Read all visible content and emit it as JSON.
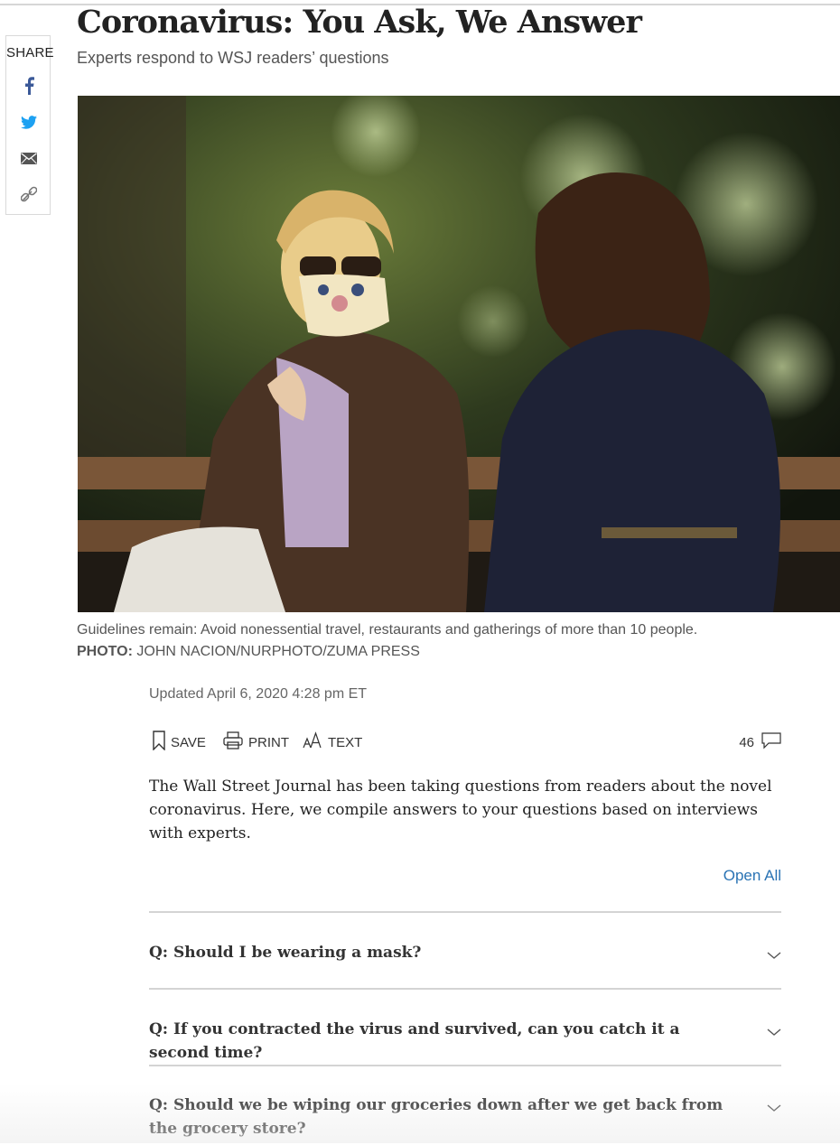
{
  "share": {
    "label": "SHARE",
    "buttons": [
      {
        "icon": "facebook-icon",
        "color": "#3b5998"
      },
      {
        "icon": "twitter-icon",
        "color": "#1da1f2"
      },
      {
        "icon": "email-icon",
        "color": "#555555"
      },
      {
        "icon": "link-icon",
        "color": "#666666"
      }
    ]
  },
  "article": {
    "headline": "Coronavirus: You Ask, We Answer",
    "dek": "Experts respond to WSJ readers’ questions",
    "caption": "Guidelines remain: Avoid nonessential travel, restaurants and gatherings of more than 10 people.",
    "credit_label": "PHOTO:",
    "credit": " JOHN NACION/NURPHOTO/ZUMA PRESS",
    "updated": "Updated April 6, 2020 4:28 pm ET",
    "intro": "The Wall Street Journal has been taking questions from readers about the novel coronavirus. Here, we compile answers to your questions based on interviews with experts."
  },
  "tools": {
    "save": "SAVE",
    "print": "PRINT",
    "text": "TEXT",
    "comments_count": "46"
  },
  "open_all": "Open All",
  "faqs": [
    "Q: Should I be wearing a mask?",
    "Q: If you contracted the virus and survived, can you catch it a second time?",
    "Q: Should we be wiping our groceries down after we get back from the grocery store?"
  ],
  "colors": {
    "link": "#2a73b4",
    "divider": "#d4d4d4"
  }
}
